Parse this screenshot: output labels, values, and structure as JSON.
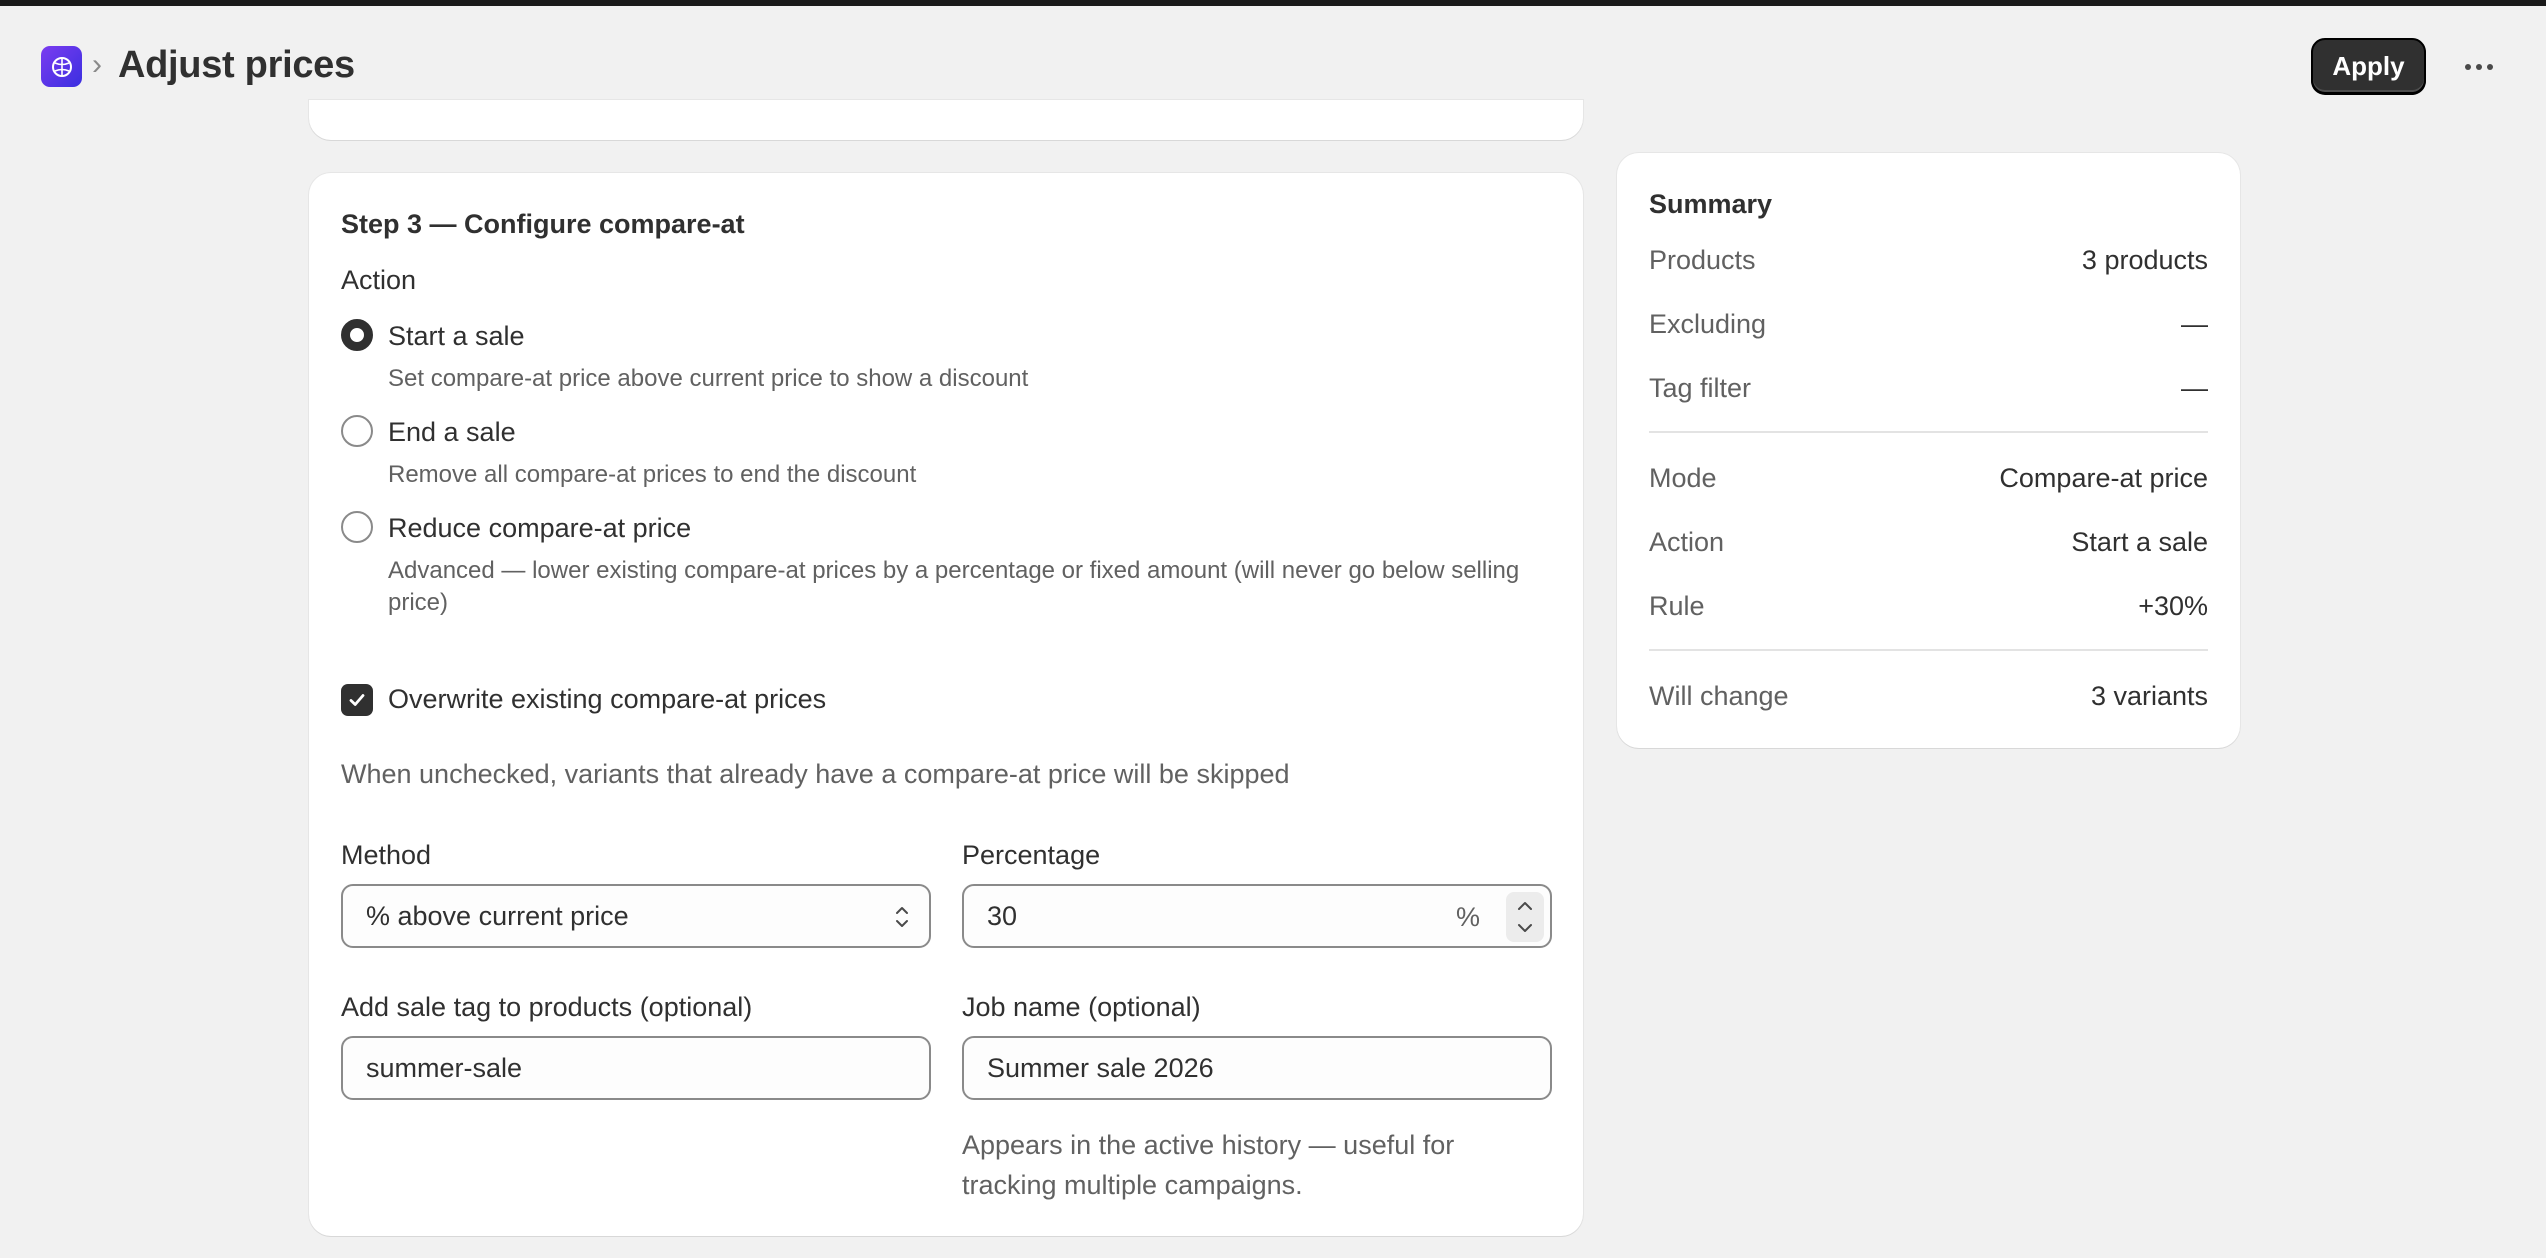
{
  "header": {
    "title": "Adjust prices",
    "apply_label": "Apply",
    "more_label": "More actions"
  },
  "step3": {
    "title": "Step 3 — Configure compare-at",
    "action_label": "Action",
    "options": [
      {
        "label": "Start a sale",
        "help": "Set compare-at price above current price to show a discount",
        "selected": true
      },
      {
        "label": "End a sale",
        "help": "Remove all compare-at prices to end the discount",
        "selected": false
      },
      {
        "label": "Reduce compare-at price",
        "help": "Advanced — lower existing compare-at prices by a percentage or fixed amount (will never go below selling price)",
        "selected": false
      }
    ],
    "overwrite": {
      "label": "Overwrite existing compare-at prices",
      "checked": true,
      "help": "When unchecked, variants that already have a compare-at price will be skipped"
    },
    "method": {
      "label": "Method",
      "value": "% above current price"
    },
    "percentage": {
      "label": "Percentage",
      "value": "30",
      "suffix": "%"
    },
    "sale_tag": {
      "label": "Add sale tag to products (optional)",
      "value": "summer-sale"
    },
    "job_name": {
      "label": "Job name (optional)",
      "value": "Summer sale 2026",
      "help": "Appears in the active history — useful for tracking multiple campaigns."
    }
  },
  "summary": {
    "title": "Summary",
    "rows": [
      {
        "key": "Products",
        "value": "3 products"
      },
      {
        "key": "Excluding",
        "value": "—"
      },
      {
        "key": "Tag filter",
        "value": "—"
      },
      {
        "key": "Mode",
        "value": "Compare-at price"
      },
      {
        "key": "Action",
        "value": "Start a sale"
      },
      {
        "key": "Rule",
        "value": "+30%"
      },
      {
        "key": "Will change",
        "value": "3 variants"
      }
    ]
  },
  "colors": {
    "background": "#f1f1f1",
    "primary_button": "#303030",
    "app_icon_from": "#7b3cf0",
    "app_icon_to": "#3a2fe0"
  }
}
